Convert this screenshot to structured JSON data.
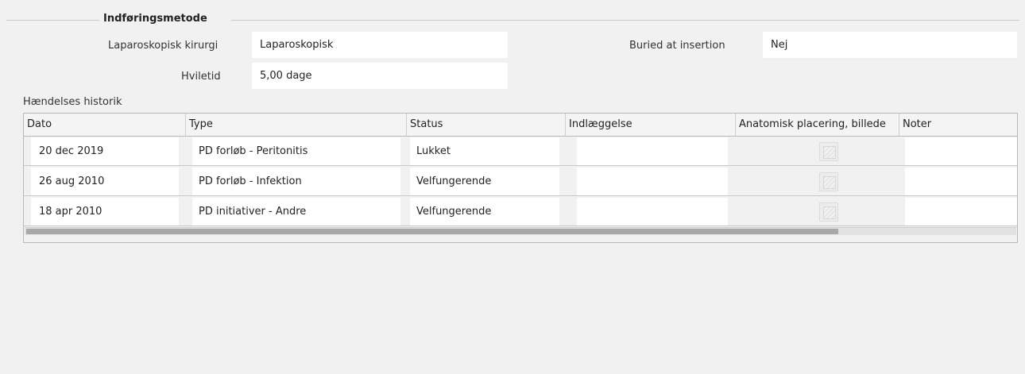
{
  "section": {
    "title": "Indføringsmetode"
  },
  "form": {
    "laparoscopic_label": "Laparoskopisk kirurgi",
    "laparoscopic_value": "Laparoskopisk",
    "rest_label": "Hviletid",
    "rest_value": "5,00  dage",
    "buried_label": "Buried at insertion",
    "buried_value": "Nej"
  },
  "history": {
    "title": "Hændelses historik",
    "columns": [
      "Dato",
      "Type",
      "Status",
      "Indlæggelse",
      "Anatomisk placering, billede",
      "Noter"
    ],
    "rows": [
      {
        "date": "20 dec 2019",
        "type": "PD forløb - Peritonitis",
        "status": "Lukket",
        "admission": "",
        "notes": ""
      },
      {
        "date": "26 aug 2010",
        "type": "PD forløb - Infektion",
        "status": "Velfungerende",
        "admission": "",
        "notes": ""
      },
      {
        "date": "18 apr 2010",
        "type": "PD initiativer - Andre",
        "status": "Velfungerende",
        "admission": "",
        "notes": ""
      }
    ]
  },
  "icons": {
    "image_placeholder": "image-placeholder-icon"
  },
  "colors": {
    "background": "#f1f1f1",
    "field": "#ffffff",
    "scroll_thumb": "#a8a8a8"
  }
}
